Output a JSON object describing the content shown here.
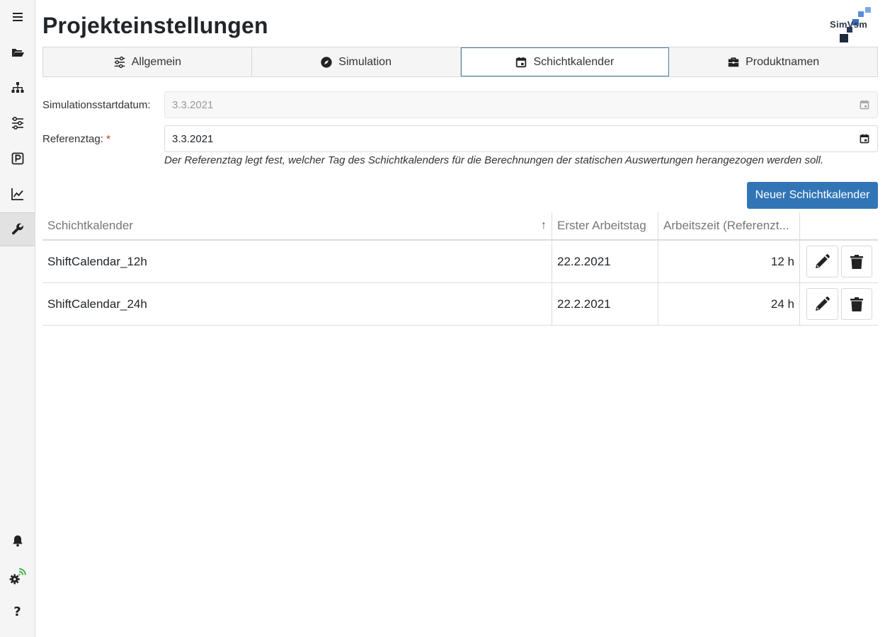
{
  "sidebar": {
    "items": [
      {
        "name": "menu-icon"
      },
      {
        "name": "folder-open-icon"
      },
      {
        "name": "sitemap-icon"
      },
      {
        "name": "sliders-icon"
      },
      {
        "name": "parking-icon"
      },
      {
        "name": "line-chart-icon"
      },
      {
        "name": "wrench-icon",
        "active": true
      }
    ],
    "bottom": [
      {
        "name": "bell-icon"
      },
      {
        "name": "gear-wifi-icon"
      },
      {
        "name": "help-icon",
        "glyph": "?"
      }
    ]
  },
  "header": {
    "title": "Projekteinstellungen",
    "logo_text": "SimVsm"
  },
  "tabs": [
    {
      "label": "Allgemein",
      "icon": "sliders-icon"
    },
    {
      "label": "Simulation",
      "icon": "compass-icon"
    },
    {
      "label": "Schichtkalender",
      "icon": "calendar-icon",
      "active": true
    },
    {
      "label": "Produktnamen",
      "icon": "briefcase-icon"
    }
  ],
  "form": {
    "start_label": "Simulationsstartdatum:",
    "start_value": "3.3.2021",
    "ref_label": "Referenztag:",
    "required_mark": "*",
    "ref_value": "3.3.2021",
    "hint": "Der Referenztag legt fest, welcher Tag des Schichtkalenders für die Berechnungen der statischen Auswertungen herangezogen werden soll."
  },
  "new_button_label": "Neuer Schichtkalender",
  "table": {
    "columns": [
      "Schichtkalender",
      "Erster Arbeitstag",
      "Arbeitszeit (Referenzt..."
    ],
    "sort_glyph": "↑",
    "rows": [
      {
        "name": "ShiftCalendar_12h",
        "first_day": "22.2.2021",
        "hours": "12 h"
      },
      {
        "name": "ShiftCalendar_24h",
        "first_day": "22.2.2021",
        "hours": "24 h"
      }
    ]
  },
  "colors": {
    "primary": "#3275b7",
    "active_tab_border": "#4a7fa7",
    "required": "#c0392b",
    "wifi": "#3cb043"
  }
}
